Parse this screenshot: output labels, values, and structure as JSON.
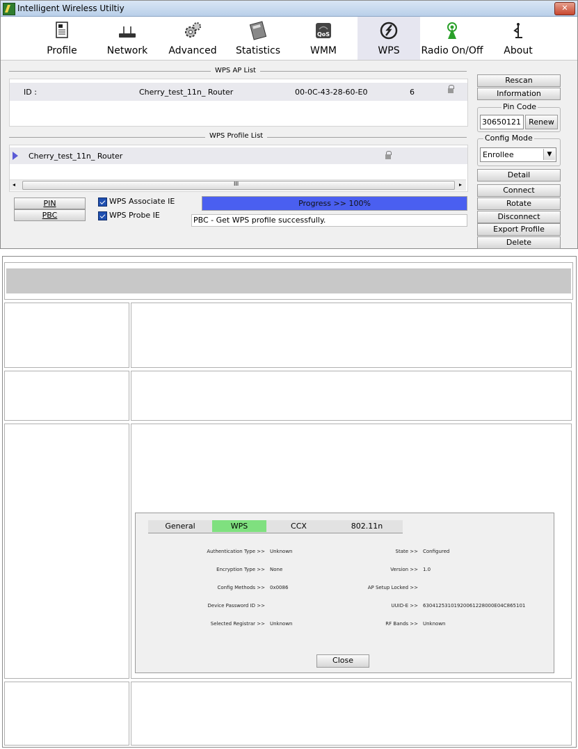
{
  "window": {
    "title": "Intelligent Wireless Utiltiy",
    "close_label": "✕"
  },
  "toolbar": {
    "items": [
      {
        "label": "Profile",
        "icon": "profile-icon"
      },
      {
        "label": "Network",
        "icon": "network-icon"
      },
      {
        "label": "Advanced",
        "icon": "advanced-icon"
      },
      {
        "label": "Statistics",
        "icon": "statistics-icon"
      },
      {
        "label": "WMM",
        "icon": "wmm-icon",
        "icon_text": "QoS"
      },
      {
        "label": "WPS",
        "icon": "wps-icon",
        "active": true
      },
      {
        "label": "Radio On/Off",
        "icon": "radio-icon"
      },
      {
        "label": "About",
        "icon": "about-icon"
      }
    ]
  },
  "ap_list": {
    "title": "WPS AP List",
    "row": {
      "id_label": "ID :",
      "ssid": "Cherry_test_11n_ Router",
      "bssid": "00-0C-43-28-60-E0",
      "channel": "6"
    }
  },
  "profile_list": {
    "title": "WPS Profile List",
    "row": {
      "name": "Cherry_test_11n_ Router"
    },
    "scroll_thumb": "III"
  },
  "bottom": {
    "pin_label": "PIN",
    "pbc_label": "PBC",
    "associate_ie": "WPS Associate IE",
    "probe_ie": "WPS Probe IE",
    "progress_text": "Progress >> 100%",
    "progress_value": 1.0,
    "status": "PBC - Get WPS profile successfully."
  },
  "side": {
    "rescan": "Rescan",
    "information": "Information",
    "pin_code_title": "Pin Code",
    "pin_code": "30650121",
    "renew": "Renew",
    "config_mode_title": "Config Mode",
    "config_mode": "Enrollee",
    "detail": "Detail",
    "connect": "Connect",
    "rotate": "Rotate",
    "disconnect": "Disconnect",
    "export_profile": "Export Profile",
    "delete": "Delete"
  },
  "dialog": {
    "tabs": [
      "General",
      "WPS",
      "CCX",
      "802.11n"
    ],
    "active_tab": "WPS",
    "fields": {
      "auth_label": "Authentication Type >>",
      "auth_value": "Unknown",
      "enc_label": "Encryption Type >>",
      "enc_value": "None",
      "config_label": "Config Methods >>",
      "config_value": "0x0086",
      "devpw_label": "Device Password ID >>",
      "devpw_value": "",
      "selreg_label": "Selected Registrar >>",
      "selreg_value": "Unknown",
      "state_label": "State >>",
      "state_value": "Configured",
      "version_label": "Version >>",
      "version_value": "1.0",
      "aplocked_label": "AP Setup Locked >>",
      "aplocked_value": "",
      "uuid_label": "UUID-E >>",
      "uuid_value": "63041253101920061228000E04C865101",
      "rf_label": "RF Bands >>",
      "rf_value": "Unknown"
    },
    "close": "Close"
  },
  "colors": {
    "progress": "#4a5ff0",
    "active_tab": "#7fe07f",
    "header_band": "#c8c8c8"
  }
}
